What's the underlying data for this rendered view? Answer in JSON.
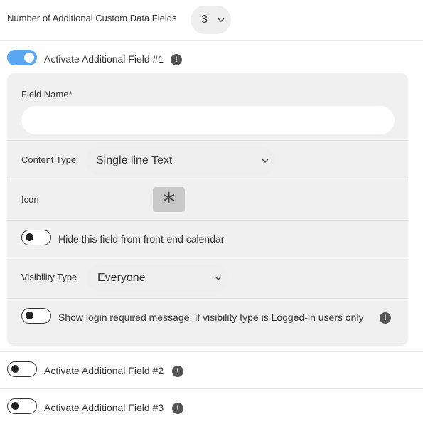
{
  "header": {
    "label": "Number of Additional Custom Data Fields",
    "count_value": "3"
  },
  "field1": {
    "activate_label": "Activate Additional Field #1",
    "toggle_on": true,
    "info_glyph": "!",
    "field_name_label": "Field Name*",
    "field_name_value": "",
    "content_type_label": "Content Type",
    "content_type_value": "Single line Text",
    "icon_label": "Icon",
    "icon_glyph": "*",
    "hide_label": "Hide this field from front-end calendar",
    "visibility_label": "Visibility Type",
    "visibility_value": "Everyone",
    "login_msg_label": "Show login required message, if visibility type is Logged-in users only"
  },
  "field2": {
    "activate_label": "Activate Additional Field #2",
    "info_glyph": "!"
  },
  "field3": {
    "activate_label": "Activate Additional Field #3",
    "info_glyph": "!"
  },
  "colors": {
    "toggle_on": "#5aa7f2",
    "panel_bg": "#f0f0f0",
    "pill_bg": "#eeeeee"
  }
}
